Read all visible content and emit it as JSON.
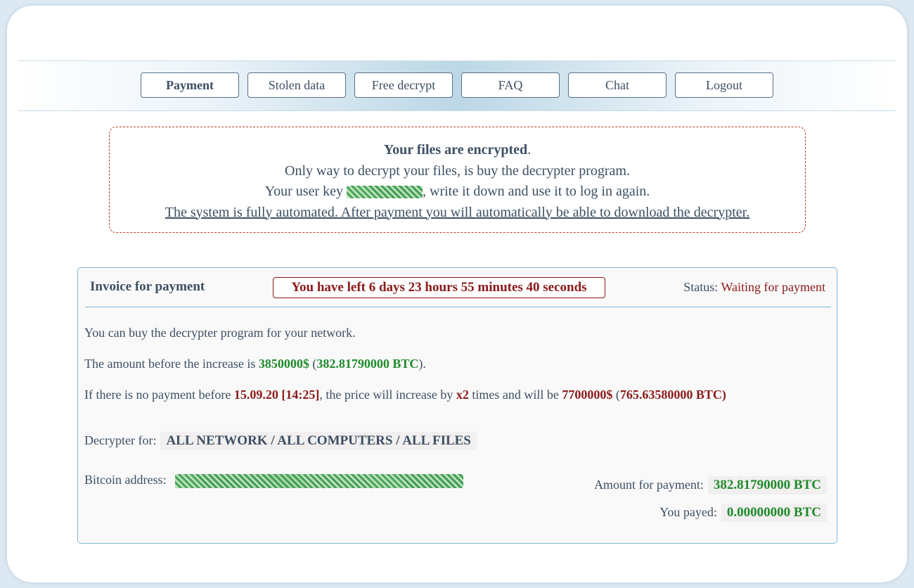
{
  "nav": {
    "items": [
      {
        "label": "Payment",
        "active": true
      },
      {
        "label": "Stolen data",
        "active": false
      },
      {
        "label": "Free decrypt",
        "active": false
      },
      {
        "label": "FAQ",
        "active": false
      },
      {
        "label": "Chat",
        "active": false
      },
      {
        "label": "Logout",
        "active": false
      }
    ]
  },
  "notice": {
    "title": "Your files are encrypted",
    "title_suffix": ".",
    "line2": "Only way to decrypt your files, is buy the decrypter program.",
    "line3_prefix": "Your user key ",
    "line3_suffix": ", write it down and use it to log in again.",
    "line4": "The system is fully automated. After payment you will automatically be able to download the decrypter."
  },
  "invoice": {
    "title": "Invoice for payment",
    "timer": "You have left 6 days 23 hours 55 minutes 40 seconds",
    "status_label": "Status:",
    "status_value": "Waiting for payment",
    "intro": "You can buy the decrypter program for your network.",
    "amount_prefix": "The amount before the increase is ",
    "amount_usd": "3850000$",
    "amount_open": " (",
    "amount_btc": "382.81790000 BTC",
    "amount_close": ").",
    "increase_p1": "If there is no payment before ",
    "increase_date": "15.09.20 [14:25]",
    "increase_p2": ", the price will increase by ",
    "increase_factor": "x2",
    "increase_p3": " times and will be ",
    "increase_usd": "7700000$",
    "increase_open": " (",
    "increase_btc": "765.63580000 BTC)",
    "decrypter_label": "Decrypter for:",
    "decrypter_value": "ALL NETWORK / ALL COMPUTERS / ALL FILES",
    "bitcoin_label": "Bitcoin address:",
    "amount_pay_label": "Amount for payment:",
    "amount_pay_value": "382.81790000 BTC",
    "payed_label": "You payed:",
    "payed_value": "0.00000000 BTC"
  },
  "colors": {
    "accent_green": "#1f8a2b",
    "accent_red": "#8b1a1a",
    "border_blue": "#7fb7d6"
  }
}
